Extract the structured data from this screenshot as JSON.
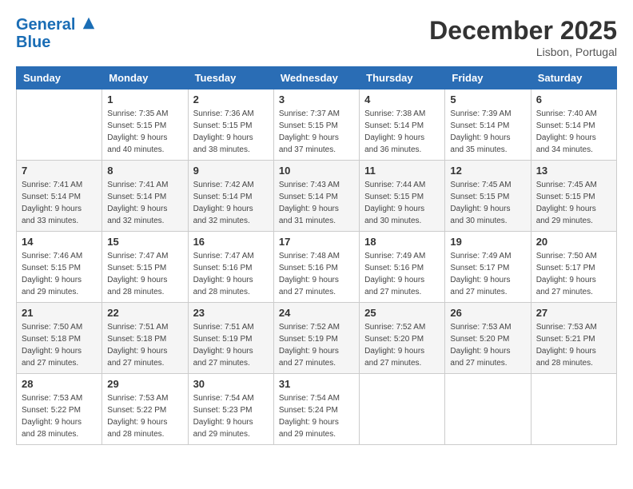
{
  "header": {
    "logo_line1": "General",
    "logo_line2": "Blue",
    "month": "December 2025",
    "location": "Lisbon, Portugal"
  },
  "weekdays": [
    "Sunday",
    "Monday",
    "Tuesday",
    "Wednesday",
    "Thursday",
    "Friday",
    "Saturday"
  ],
  "weeks": [
    [
      {
        "day": "",
        "sunrise": "",
        "sunset": "",
        "daylight": ""
      },
      {
        "day": "1",
        "sunrise": "Sunrise: 7:35 AM",
        "sunset": "Sunset: 5:15 PM",
        "daylight": "Daylight: 9 hours and 40 minutes."
      },
      {
        "day": "2",
        "sunrise": "Sunrise: 7:36 AM",
        "sunset": "Sunset: 5:15 PM",
        "daylight": "Daylight: 9 hours and 38 minutes."
      },
      {
        "day": "3",
        "sunrise": "Sunrise: 7:37 AM",
        "sunset": "Sunset: 5:15 PM",
        "daylight": "Daylight: 9 hours and 37 minutes."
      },
      {
        "day": "4",
        "sunrise": "Sunrise: 7:38 AM",
        "sunset": "Sunset: 5:14 PM",
        "daylight": "Daylight: 9 hours and 36 minutes."
      },
      {
        "day": "5",
        "sunrise": "Sunrise: 7:39 AM",
        "sunset": "Sunset: 5:14 PM",
        "daylight": "Daylight: 9 hours and 35 minutes."
      },
      {
        "day": "6",
        "sunrise": "Sunrise: 7:40 AM",
        "sunset": "Sunset: 5:14 PM",
        "daylight": "Daylight: 9 hours and 34 minutes."
      }
    ],
    [
      {
        "day": "7",
        "sunrise": "Sunrise: 7:41 AM",
        "sunset": "Sunset: 5:14 PM",
        "daylight": "Daylight: 9 hours and 33 minutes."
      },
      {
        "day": "8",
        "sunrise": "Sunrise: 7:41 AM",
        "sunset": "Sunset: 5:14 PM",
        "daylight": "Daylight: 9 hours and 32 minutes."
      },
      {
        "day": "9",
        "sunrise": "Sunrise: 7:42 AM",
        "sunset": "Sunset: 5:14 PM",
        "daylight": "Daylight: 9 hours and 32 minutes."
      },
      {
        "day": "10",
        "sunrise": "Sunrise: 7:43 AM",
        "sunset": "Sunset: 5:14 PM",
        "daylight": "Daylight: 9 hours and 31 minutes."
      },
      {
        "day": "11",
        "sunrise": "Sunrise: 7:44 AM",
        "sunset": "Sunset: 5:15 PM",
        "daylight": "Daylight: 9 hours and 30 minutes."
      },
      {
        "day": "12",
        "sunrise": "Sunrise: 7:45 AM",
        "sunset": "Sunset: 5:15 PM",
        "daylight": "Daylight: 9 hours and 30 minutes."
      },
      {
        "day": "13",
        "sunrise": "Sunrise: 7:45 AM",
        "sunset": "Sunset: 5:15 PM",
        "daylight": "Daylight: 9 hours and 29 minutes."
      }
    ],
    [
      {
        "day": "14",
        "sunrise": "Sunrise: 7:46 AM",
        "sunset": "Sunset: 5:15 PM",
        "daylight": "Daylight: 9 hours and 29 minutes."
      },
      {
        "day": "15",
        "sunrise": "Sunrise: 7:47 AM",
        "sunset": "Sunset: 5:15 PM",
        "daylight": "Daylight: 9 hours and 28 minutes."
      },
      {
        "day": "16",
        "sunrise": "Sunrise: 7:47 AM",
        "sunset": "Sunset: 5:16 PM",
        "daylight": "Daylight: 9 hours and 28 minutes."
      },
      {
        "day": "17",
        "sunrise": "Sunrise: 7:48 AM",
        "sunset": "Sunset: 5:16 PM",
        "daylight": "Daylight: 9 hours and 27 minutes."
      },
      {
        "day": "18",
        "sunrise": "Sunrise: 7:49 AM",
        "sunset": "Sunset: 5:16 PM",
        "daylight": "Daylight: 9 hours and 27 minutes."
      },
      {
        "day": "19",
        "sunrise": "Sunrise: 7:49 AM",
        "sunset": "Sunset: 5:17 PM",
        "daylight": "Daylight: 9 hours and 27 minutes."
      },
      {
        "day": "20",
        "sunrise": "Sunrise: 7:50 AM",
        "sunset": "Sunset: 5:17 PM",
        "daylight": "Daylight: 9 hours and 27 minutes."
      }
    ],
    [
      {
        "day": "21",
        "sunrise": "Sunrise: 7:50 AM",
        "sunset": "Sunset: 5:18 PM",
        "daylight": "Daylight: 9 hours and 27 minutes."
      },
      {
        "day": "22",
        "sunrise": "Sunrise: 7:51 AM",
        "sunset": "Sunset: 5:18 PM",
        "daylight": "Daylight: 9 hours and 27 minutes."
      },
      {
        "day": "23",
        "sunrise": "Sunrise: 7:51 AM",
        "sunset": "Sunset: 5:19 PM",
        "daylight": "Daylight: 9 hours and 27 minutes."
      },
      {
        "day": "24",
        "sunrise": "Sunrise: 7:52 AM",
        "sunset": "Sunset: 5:19 PM",
        "daylight": "Daylight: 9 hours and 27 minutes."
      },
      {
        "day": "25",
        "sunrise": "Sunrise: 7:52 AM",
        "sunset": "Sunset: 5:20 PM",
        "daylight": "Daylight: 9 hours and 27 minutes."
      },
      {
        "day": "26",
        "sunrise": "Sunrise: 7:53 AM",
        "sunset": "Sunset: 5:20 PM",
        "daylight": "Daylight: 9 hours and 27 minutes."
      },
      {
        "day": "27",
        "sunrise": "Sunrise: 7:53 AM",
        "sunset": "Sunset: 5:21 PM",
        "daylight": "Daylight: 9 hours and 28 minutes."
      }
    ],
    [
      {
        "day": "28",
        "sunrise": "Sunrise: 7:53 AM",
        "sunset": "Sunset: 5:22 PM",
        "daylight": "Daylight: 9 hours and 28 minutes."
      },
      {
        "day": "29",
        "sunrise": "Sunrise: 7:53 AM",
        "sunset": "Sunset: 5:22 PM",
        "daylight": "Daylight: 9 hours and 28 minutes."
      },
      {
        "day": "30",
        "sunrise": "Sunrise: 7:54 AM",
        "sunset": "Sunset: 5:23 PM",
        "daylight": "Daylight: 9 hours and 29 minutes."
      },
      {
        "day": "31",
        "sunrise": "Sunrise: 7:54 AM",
        "sunset": "Sunset: 5:24 PM",
        "daylight": "Daylight: 9 hours and 29 minutes."
      },
      {
        "day": "",
        "sunrise": "",
        "sunset": "",
        "daylight": ""
      },
      {
        "day": "",
        "sunrise": "",
        "sunset": "",
        "daylight": ""
      },
      {
        "day": "",
        "sunrise": "",
        "sunset": "",
        "daylight": ""
      }
    ]
  ]
}
